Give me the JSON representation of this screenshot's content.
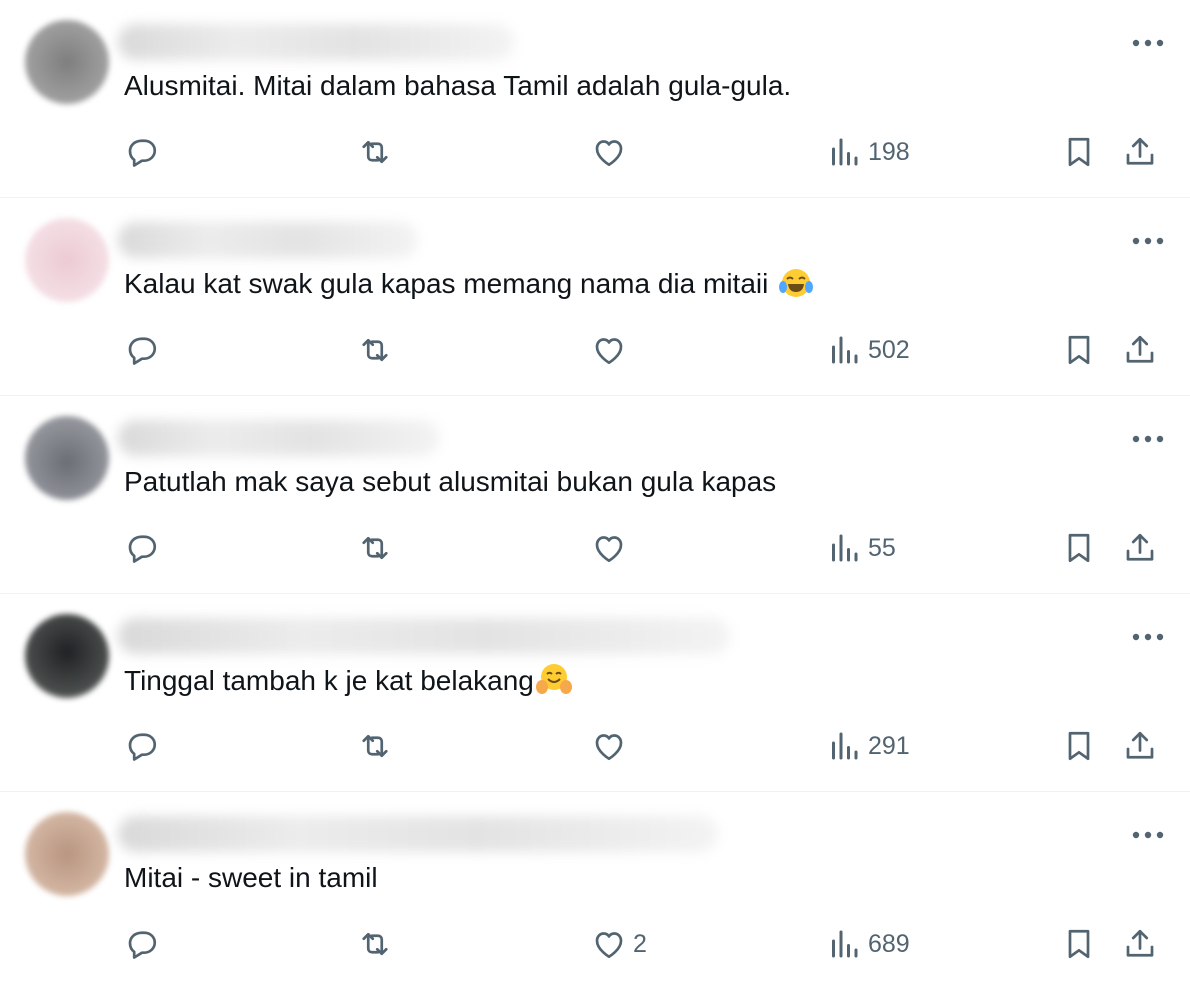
{
  "replies": [
    {
      "text": "Alusmitai. Mitai dalam bahasa Tamil adalah gula-gula.",
      "emoji": "",
      "likes": "",
      "views": "198",
      "avatar_color": "#8f8f8f"
    },
    {
      "text": "Kalau kat swak gula kapas memang nama dia mitaii ",
      "emoji": "face-with-tears-of-joy",
      "likes": "",
      "views": "502",
      "avatar_color": "#f2d6dd"
    },
    {
      "text": "Patutlah mak saya sebut alusmitai bukan gula kapas",
      "emoji": "",
      "likes": "",
      "views": "55",
      "avatar_color": "#7d7f86"
    },
    {
      "text": "Tinggal tambah k je kat belakang",
      "emoji": "hugging-face",
      "likes": "",
      "views": "291",
      "avatar_color": "#3a3d3c"
    },
    {
      "text": "Mitai - sweet in tamil",
      "emoji": "",
      "likes": "2",
      "views": "689",
      "avatar_color": "#c9a892"
    }
  ],
  "icons": {
    "reply": "reply-icon",
    "retweet": "retweet-icon",
    "like": "heart-icon",
    "views": "views-icon",
    "bookmark": "bookmark-icon",
    "share": "share-icon",
    "more": "more-icon"
  },
  "colors": {
    "text": "#0f1419",
    "secondary": "#536471",
    "divider": "#eff3f4"
  }
}
